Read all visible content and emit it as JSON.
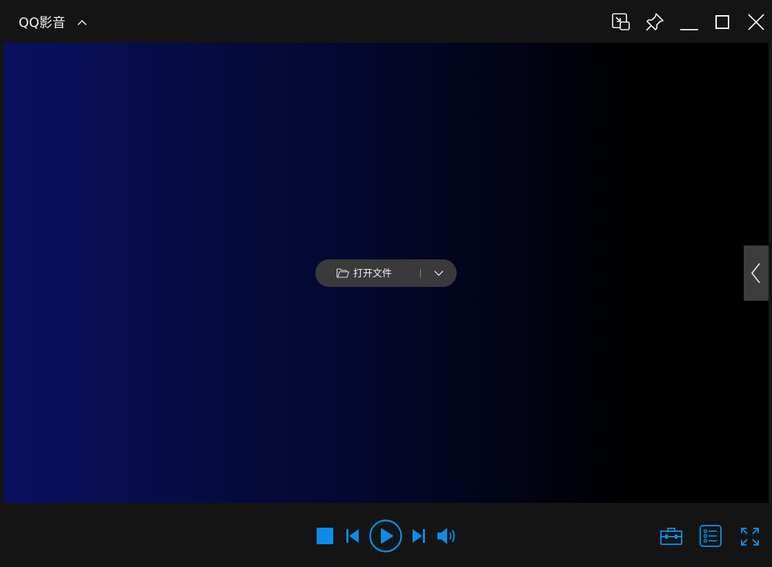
{
  "app": {
    "title": "QQ影音"
  },
  "window_controls": [
    {
      "name": "mini-mode-button",
      "icon": "mini-mode-icon"
    },
    {
      "name": "pin-button",
      "icon": "pin-icon"
    },
    {
      "name": "minimize-button",
      "icon": "minimize-icon"
    },
    {
      "name": "maximize-button",
      "icon": "maximize-icon"
    },
    {
      "name": "close-button",
      "icon": "close-icon"
    }
  ],
  "center": {
    "open_file_label": "打开文件",
    "open_icon": "folder-icon",
    "dropdown_icon": "chevron-down-icon"
  },
  "side_panel": {
    "icon": "chevron-left-icon"
  },
  "player_controls": {
    "accent": "#0c8ce9",
    "buttons": [
      "stop-icon",
      "previous-icon",
      "play-icon",
      "next-icon",
      "volume-icon",
      "toolbox-icon",
      "playlist-icon",
      "fullscreen-icon"
    ]
  },
  "colors": {
    "background": "#141414",
    "video_gradient_left": "#0a1060",
    "video_gradient_right": "#000000",
    "pill": "#3a3a3a"
  }
}
